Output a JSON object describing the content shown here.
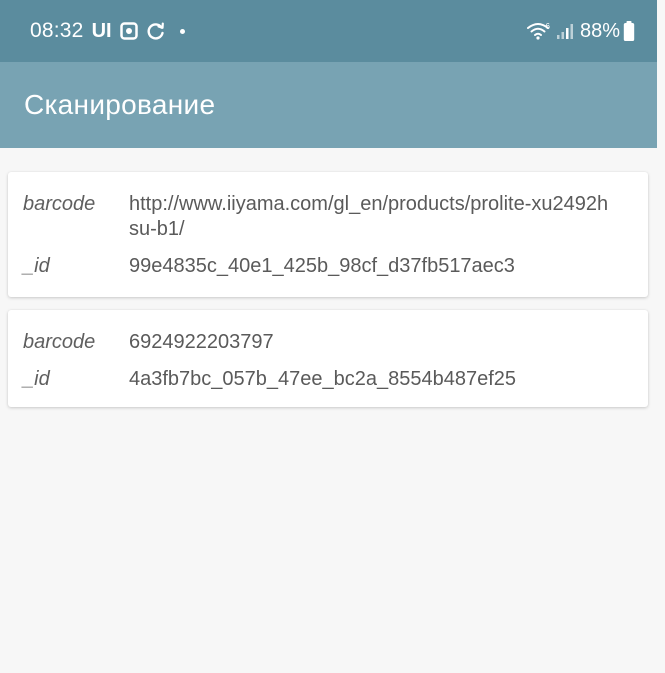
{
  "status_bar": {
    "time": "08:32",
    "ui_label": "UI",
    "battery": "88%",
    "icons": [
      "screen-record-icon",
      "sync-icon",
      "notification-dot-icon",
      "wifi-icon",
      "signal-icon",
      "battery-icon"
    ]
  },
  "app_bar": {
    "title": "Сканирование"
  },
  "records": [
    {
      "barcode_key": "barcode",
      "barcode": "http://www.iiyama.com/gl_en/products/prolite-xu2492hsu-b1/",
      "id_key": "_id",
      "id": "99e4835c_40e1_425b_98cf_d37fb517aec3"
    },
    {
      "barcode_key": "barcode",
      "barcode": "6924922203797",
      "id_key": "_id",
      "id": "4a3fb7bc_057b_47ee_bc2a_8554b487ef25"
    }
  ],
  "colors": {
    "status_bar": "#5b8c9e",
    "app_bar": "#78a3b3",
    "background": "#f7f7f7",
    "card": "#ffffff",
    "text": "#5a5a5a"
  }
}
